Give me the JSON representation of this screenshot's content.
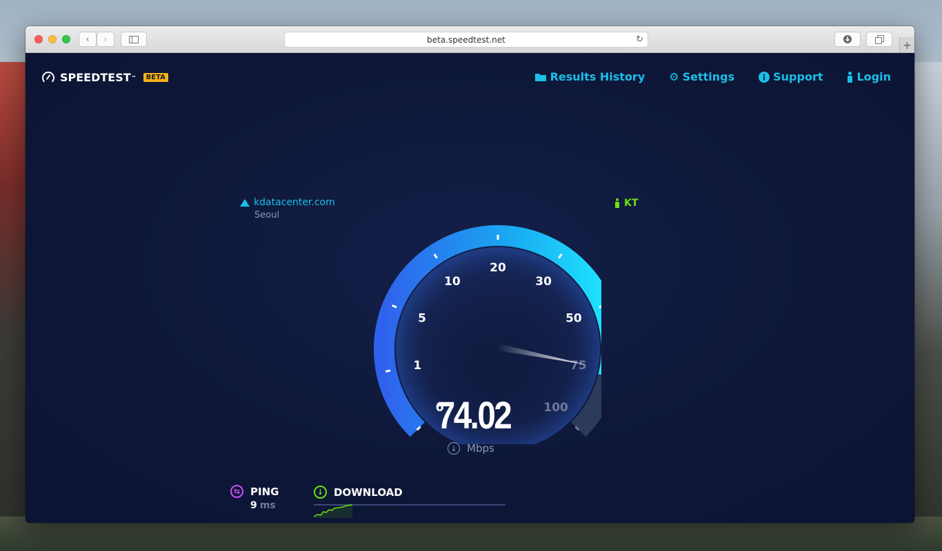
{
  "browser": {
    "url": "beta.speedtest.net",
    "new_tab_label": "+"
  },
  "header": {
    "logo_text": "SPEEDTEST",
    "logo_tm": "™",
    "beta_badge": "BETA",
    "nav": [
      {
        "label": "Results History",
        "icon": "folder-icon"
      },
      {
        "label": "Settings",
        "icon": "gear-icon"
      },
      {
        "label": "Support",
        "icon": "info-icon"
      },
      {
        "label": "Login",
        "icon": "person-icon"
      }
    ]
  },
  "server": {
    "host": "kdatacenter.com",
    "city": "Seoul"
  },
  "isp": {
    "name": "KT"
  },
  "gauge": {
    "labels": [
      "0",
      "1",
      "5",
      "10",
      "20",
      "30",
      "50",
      "75",
      "100"
    ],
    "max_label": "100",
    "needle_value_mbps": 74.02,
    "colors": {
      "start": "#2f6cf0",
      "end": "#1de5ff",
      "track": "#2c3a5c"
    }
  },
  "result": {
    "speed": "74.02",
    "unit": "Mbps"
  },
  "ping": {
    "label": "PING",
    "value": "9",
    "unit": "ms"
  },
  "download": {
    "label": "DOWNLOAD"
  }
}
